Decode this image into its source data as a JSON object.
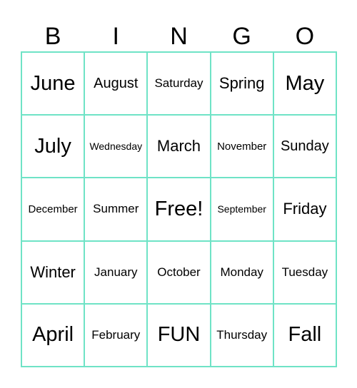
{
  "header": [
    "B",
    "I",
    "N",
    "G",
    "O"
  ],
  "grid_color": "#6fe3c6",
  "cells": [
    [
      "June",
      "August",
      "Saturday",
      "Spring",
      "May"
    ],
    [
      "July",
      "Wednesday",
      "March",
      "November",
      "Sunday"
    ],
    [
      "December",
      "Summer",
      "Free!",
      "September",
      "Friday"
    ],
    [
      "Winter",
      "January",
      "October",
      "Monday",
      "Tuesday"
    ],
    [
      "April",
      "February",
      "FUN",
      "Thursday",
      "Fall"
    ]
  ]
}
